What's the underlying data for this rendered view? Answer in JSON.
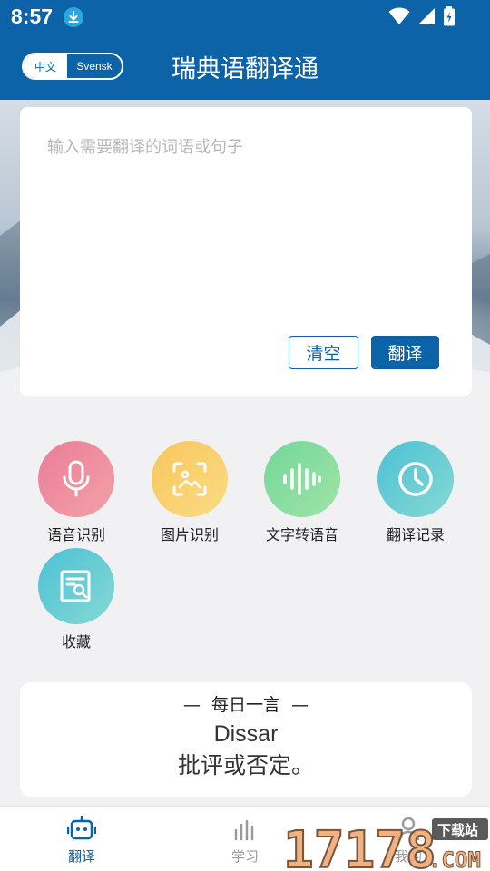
{
  "status_bar": {
    "time": "8:57",
    "icons": [
      "download-icon",
      "wifi-icon",
      "signal-icon",
      "battery-icon"
    ]
  },
  "header": {
    "title": "瑞典语翻译通",
    "lang_left": "中文",
    "lang_right": "Svensk"
  },
  "input": {
    "placeholder": "输入需要翻译的词语或句子",
    "clear_label": "清空",
    "translate_label": "翻译"
  },
  "features": [
    {
      "label": "语音识别",
      "icon": "microphone-icon",
      "colors": [
        "#ea7d98",
        "#f2a2a7"
      ]
    },
    {
      "label": "图片识别",
      "icon": "image-scan-icon",
      "colors": [
        "#f7c65d",
        "#fbdc84"
      ]
    },
    {
      "label": "文字转语音",
      "icon": "sound-wave-icon",
      "colors": [
        "#74d69a",
        "#9fe4a6"
      ]
    },
    {
      "label": "翻译记录",
      "icon": "clock-icon",
      "colors": [
        "#4cc1d4",
        "#86d9d3"
      ]
    },
    {
      "label": "收藏",
      "icon": "bookmark-search-icon",
      "colors": [
        "#4cc1d4",
        "#86d9d3"
      ]
    }
  ],
  "daily_quote": {
    "title": "每日一言",
    "word": "Dissar",
    "meaning": "批评或否定。"
  },
  "bottom_nav": [
    {
      "label": "翻译",
      "icon": "robot-icon",
      "active": true
    },
    {
      "label": "学习",
      "icon": "bars-icon",
      "active": false
    },
    {
      "label": "我的",
      "icon": "person-icon",
      "active": false
    }
  ],
  "colors": {
    "brand": "#0d63a8",
    "inactive": "#9b9b9b"
  },
  "watermark": {
    "text": "17178",
    "tag": "下载站",
    "suffix": ".COM"
  }
}
